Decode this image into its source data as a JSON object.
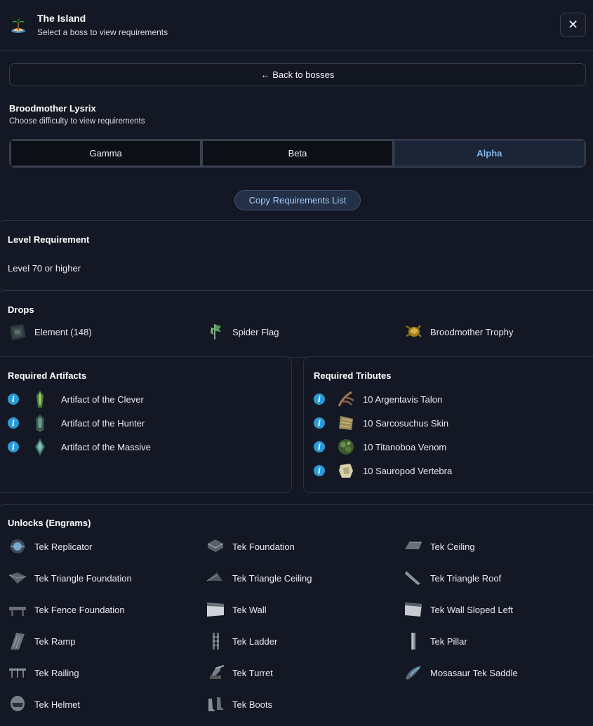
{
  "header": {
    "title": "The Island",
    "subtitle": "Select a boss to view requirements",
    "close_label": "✕"
  },
  "back_button": "← Back to bosses",
  "boss": {
    "name": "Broodmother Lysrix",
    "subtitle": "Choose difficulty to view requirements"
  },
  "difficulty_tabs": [
    {
      "label": "Gamma",
      "active": false
    },
    {
      "label": "Beta",
      "active": false
    },
    {
      "label": "Alpha",
      "active": true
    }
  ],
  "copy_button": "Copy Requirements List",
  "level_requirement": {
    "title": "Level Requirement",
    "text": "Level 70 or higher"
  },
  "drops": {
    "title": "Drops",
    "items": [
      {
        "label": "Element (148)",
        "icon": "element-icon"
      },
      {
        "label": "Spider Flag",
        "icon": "spider-flag-icon"
      },
      {
        "label": "Broodmother Trophy",
        "icon": "trophy-icon"
      }
    ]
  },
  "artifacts": {
    "title": "Required Artifacts",
    "items": [
      {
        "label": "Artifact of the Clever",
        "icon": "artifact-clever-icon"
      },
      {
        "label": "Artifact of the Hunter",
        "icon": "artifact-hunter-icon"
      },
      {
        "label": "Artifact of the Massive",
        "icon": "artifact-massive-icon"
      }
    ]
  },
  "tributes": {
    "title": "Required Tributes",
    "items": [
      {
        "label": "10 Argentavis Talon",
        "icon": "talon-icon"
      },
      {
        "label": "10 Sarcosuchus Skin",
        "icon": "skin-icon"
      },
      {
        "label": "10 Titanoboa Venom",
        "icon": "venom-icon"
      },
      {
        "label": "10 Sauropod Vertebra",
        "icon": "vertebra-icon"
      }
    ]
  },
  "unlocks": {
    "title": "Unlocks (Engrams)",
    "items": [
      {
        "label": "Tek Replicator"
      },
      {
        "label": "Tek Foundation"
      },
      {
        "label": "Tek Ceiling"
      },
      {
        "label": "Tek Triangle Foundation"
      },
      {
        "label": "Tek Triangle Ceiling"
      },
      {
        "label": "Tek Triangle Roof"
      },
      {
        "label": "Tek Fence Foundation"
      },
      {
        "label": "Tek Wall"
      },
      {
        "label": "Tek Wall Sloped Left"
      },
      {
        "label": "Tek Ramp"
      },
      {
        "label": "Tek Ladder"
      },
      {
        "label": "Tek Pillar"
      },
      {
        "label": "Tek Railing"
      },
      {
        "label": "Tek Turret"
      },
      {
        "label": "Mosasaur Tek Saddle"
      },
      {
        "label": "Tek Helmet"
      },
      {
        "label": "Tek Boots"
      }
    ]
  },
  "colors": {
    "background": "#141824",
    "accent": "#7fb8f0",
    "info": "#2a9ad8"
  }
}
